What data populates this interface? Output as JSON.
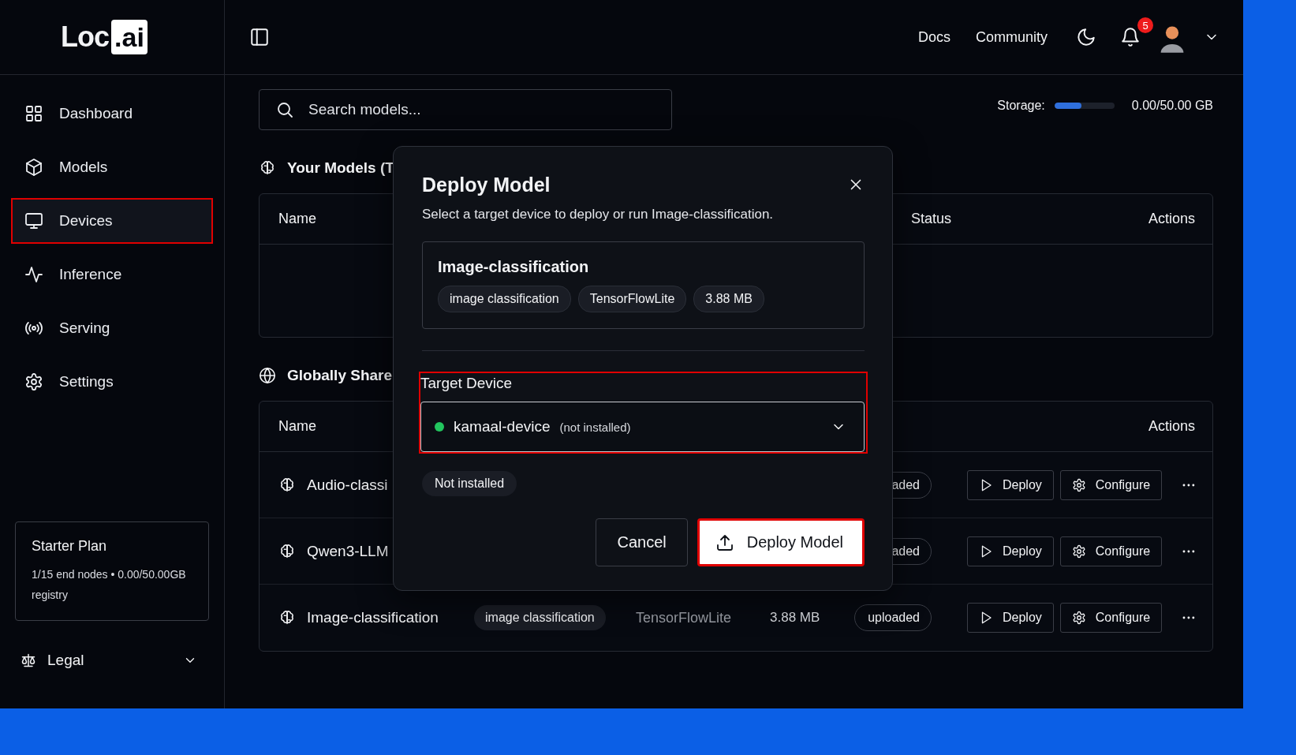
{
  "brand": {
    "name": "Loc",
    "suffix": ".ai"
  },
  "header": {
    "links": [
      "Docs",
      "Community"
    ],
    "notifications": "5"
  },
  "sidebar": {
    "items": [
      {
        "label": "Dashboard",
        "selected": false,
        "highlighted": false
      },
      {
        "label": "Models",
        "selected": false,
        "highlighted": false
      },
      {
        "label": "Devices",
        "selected": true,
        "highlighted": true
      },
      {
        "label": "Inference",
        "selected": false,
        "highlighted": false
      },
      {
        "label": "Serving",
        "selected": false,
        "highlighted": false
      },
      {
        "label": "Settings",
        "selected": false,
        "highlighted": false
      }
    ],
    "plan": {
      "title": "Starter Plan",
      "text": "1/15 end nodes • 0.00/50.00GB registry"
    },
    "footer": {
      "label": "Legal"
    }
  },
  "search": {
    "placeholder": "Search models..."
  },
  "storage": {
    "label": "Storage:",
    "level": 0.45,
    "reading": "0.00/50.00 GB"
  },
  "sections": [
    {
      "title": "Your Models (T",
      "columns": [
        {
          "label": "Name",
          "kind": "name"
        },
        {
          "label": "Status",
          "kind": "status"
        },
        {
          "label": "Actions",
          "kind": "actions"
        }
      ]
    },
    {
      "title": "Globally Share",
      "columns": [
        {
          "label": "Name",
          "kind": "name"
        },
        {
          "label": "Actions",
          "kind": "actions"
        }
      ],
      "rows": [
        {
          "name": "Audio-classi",
          "status": "aded",
          "actions": [
            "Deploy",
            "Configure"
          ]
        },
        {
          "name": "Qwen3-LLM",
          "status": "aded",
          "actions": [
            "Deploy",
            "Configure"
          ]
        },
        {
          "name": "Image-classification",
          "tag": "image classification",
          "framework": "TensorFlowLite",
          "size": "3.88 MB",
          "status": "uploaded",
          "actions": [
            "Deploy",
            "Configure"
          ]
        }
      ]
    }
  ],
  "modal": {
    "title": "Deploy Model",
    "subtitle": "Select a target device to deploy or run Image-classification.",
    "model": {
      "name": "Image-classification",
      "tags": [
        "image classification",
        "TensorFlowLite",
        "3.88 MB"
      ]
    },
    "target": {
      "label": "Target Device",
      "highlighted": true,
      "device": "kamaal-device",
      "note": "(not installed)",
      "online": true,
      "status": "Not installed"
    },
    "buttons": [
      {
        "label": "Cancel",
        "kind": "secondary",
        "highlighted": false
      },
      {
        "label": "Deploy Model",
        "kind": "primary",
        "highlighted": true
      }
    ]
  }
}
